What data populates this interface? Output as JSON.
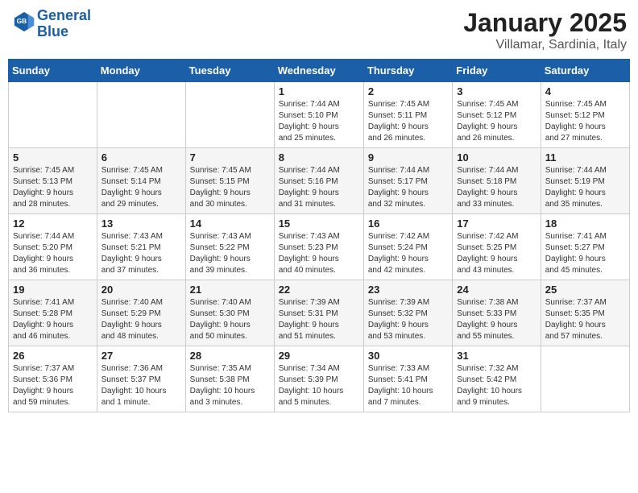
{
  "logo": {
    "line1": "General",
    "line2": "Blue"
  },
  "title": "January 2025",
  "subtitle": "Villamar, Sardinia, Italy",
  "weekdays": [
    "Sunday",
    "Monday",
    "Tuesday",
    "Wednesday",
    "Thursday",
    "Friday",
    "Saturday"
  ],
  "weeks": [
    [
      {
        "day": "",
        "info": ""
      },
      {
        "day": "",
        "info": ""
      },
      {
        "day": "",
        "info": ""
      },
      {
        "day": "1",
        "info": "Sunrise: 7:44 AM\nSunset: 5:10 PM\nDaylight: 9 hours\nand 25 minutes."
      },
      {
        "day": "2",
        "info": "Sunrise: 7:45 AM\nSunset: 5:11 PM\nDaylight: 9 hours\nand 26 minutes."
      },
      {
        "day": "3",
        "info": "Sunrise: 7:45 AM\nSunset: 5:12 PM\nDaylight: 9 hours\nand 26 minutes."
      },
      {
        "day": "4",
        "info": "Sunrise: 7:45 AM\nSunset: 5:12 PM\nDaylight: 9 hours\nand 27 minutes."
      }
    ],
    [
      {
        "day": "5",
        "info": "Sunrise: 7:45 AM\nSunset: 5:13 PM\nDaylight: 9 hours\nand 28 minutes."
      },
      {
        "day": "6",
        "info": "Sunrise: 7:45 AM\nSunset: 5:14 PM\nDaylight: 9 hours\nand 29 minutes."
      },
      {
        "day": "7",
        "info": "Sunrise: 7:45 AM\nSunset: 5:15 PM\nDaylight: 9 hours\nand 30 minutes."
      },
      {
        "day": "8",
        "info": "Sunrise: 7:44 AM\nSunset: 5:16 PM\nDaylight: 9 hours\nand 31 minutes."
      },
      {
        "day": "9",
        "info": "Sunrise: 7:44 AM\nSunset: 5:17 PM\nDaylight: 9 hours\nand 32 minutes."
      },
      {
        "day": "10",
        "info": "Sunrise: 7:44 AM\nSunset: 5:18 PM\nDaylight: 9 hours\nand 33 minutes."
      },
      {
        "day": "11",
        "info": "Sunrise: 7:44 AM\nSunset: 5:19 PM\nDaylight: 9 hours\nand 35 minutes."
      }
    ],
    [
      {
        "day": "12",
        "info": "Sunrise: 7:44 AM\nSunset: 5:20 PM\nDaylight: 9 hours\nand 36 minutes."
      },
      {
        "day": "13",
        "info": "Sunrise: 7:43 AM\nSunset: 5:21 PM\nDaylight: 9 hours\nand 37 minutes."
      },
      {
        "day": "14",
        "info": "Sunrise: 7:43 AM\nSunset: 5:22 PM\nDaylight: 9 hours\nand 39 minutes."
      },
      {
        "day": "15",
        "info": "Sunrise: 7:43 AM\nSunset: 5:23 PM\nDaylight: 9 hours\nand 40 minutes."
      },
      {
        "day": "16",
        "info": "Sunrise: 7:42 AM\nSunset: 5:24 PM\nDaylight: 9 hours\nand 42 minutes."
      },
      {
        "day": "17",
        "info": "Sunrise: 7:42 AM\nSunset: 5:25 PM\nDaylight: 9 hours\nand 43 minutes."
      },
      {
        "day": "18",
        "info": "Sunrise: 7:41 AM\nSunset: 5:27 PM\nDaylight: 9 hours\nand 45 minutes."
      }
    ],
    [
      {
        "day": "19",
        "info": "Sunrise: 7:41 AM\nSunset: 5:28 PM\nDaylight: 9 hours\nand 46 minutes."
      },
      {
        "day": "20",
        "info": "Sunrise: 7:40 AM\nSunset: 5:29 PM\nDaylight: 9 hours\nand 48 minutes."
      },
      {
        "day": "21",
        "info": "Sunrise: 7:40 AM\nSunset: 5:30 PM\nDaylight: 9 hours\nand 50 minutes."
      },
      {
        "day": "22",
        "info": "Sunrise: 7:39 AM\nSunset: 5:31 PM\nDaylight: 9 hours\nand 51 minutes."
      },
      {
        "day": "23",
        "info": "Sunrise: 7:39 AM\nSunset: 5:32 PM\nDaylight: 9 hours\nand 53 minutes."
      },
      {
        "day": "24",
        "info": "Sunrise: 7:38 AM\nSunset: 5:33 PM\nDaylight: 9 hours\nand 55 minutes."
      },
      {
        "day": "25",
        "info": "Sunrise: 7:37 AM\nSunset: 5:35 PM\nDaylight: 9 hours\nand 57 minutes."
      }
    ],
    [
      {
        "day": "26",
        "info": "Sunrise: 7:37 AM\nSunset: 5:36 PM\nDaylight: 9 hours\nand 59 minutes."
      },
      {
        "day": "27",
        "info": "Sunrise: 7:36 AM\nSunset: 5:37 PM\nDaylight: 10 hours\nand 1 minute."
      },
      {
        "day": "28",
        "info": "Sunrise: 7:35 AM\nSunset: 5:38 PM\nDaylight: 10 hours\nand 3 minutes."
      },
      {
        "day": "29",
        "info": "Sunrise: 7:34 AM\nSunset: 5:39 PM\nDaylight: 10 hours\nand 5 minutes."
      },
      {
        "day": "30",
        "info": "Sunrise: 7:33 AM\nSunset: 5:41 PM\nDaylight: 10 hours\nand 7 minutes."
      },
      {
        "day": "31",
        "info": "Sunrise: 7:32 AM\nSunset: 5:42 PM\nDaylight: 10 hours\nand 9 minutes."
      },
      {
        "day": "",
        "info": ""
      }
    ]
  ]
}
